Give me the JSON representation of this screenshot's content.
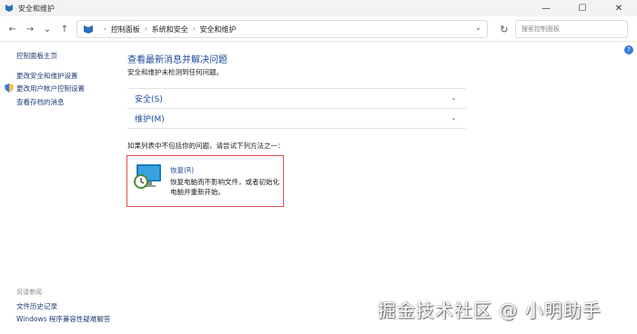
{
  "window": {
    "title": "安全和维护",
    "controls": {
      "minimize": "—",
      "maximize": "☐",
      "close": "✕"
    }
  },
  "nav": {
    "back": "←",
    "forward": "→",
    "recent": "⌄",
    "up": "↑",
    "breadcrumb": [
      "控制面板",
      "系统和安全",
      "安全和维护"
    ],
    "separator": "›",
    "dropdown": "⌄",
    "refresh": "↻",
    "search_placeholder": "搜索控制面板"
  },
  "help": "?",
  "sidebar": {
    "links": [
      "控制面板主页",
      "更改安全和维护设置",
      "更改用户帐户控制设置",
      "查看存档的消息"
    ],
    "see_also_header": "另请参阅",
    "see_also": [
      "文件历史记录",
      "Windows 程序兼容性疑难解答"
    ]
  },
  "main": {
    "title": "查看最新消息并解决问题",
    "subtitle": "安全和维护未检测到任何问题。",
    "sections": [
      {
        "label": "安全(S)",
        "chevron": "⌄"
      },
      {
        "label": "维护(M)",
        "chevron": "⌄"
      }
    ],
    "prompt": "如果列表中不包括你的问题，请尝试下列方法之一：",
    "recovery": {
      "title": "恢复(R)",
      "description": "恢复电脑而不影响文件，或者初始化电脑并重新开始。"
    }
  },
  "watermark": "掘金技术社区 @ 小明助手",
  "colors": {
    "link": "#1e4a9b",
    "highlight_border": "#d9534f",
    "titlebar_bg": "#f3f3f3"
  }
}
